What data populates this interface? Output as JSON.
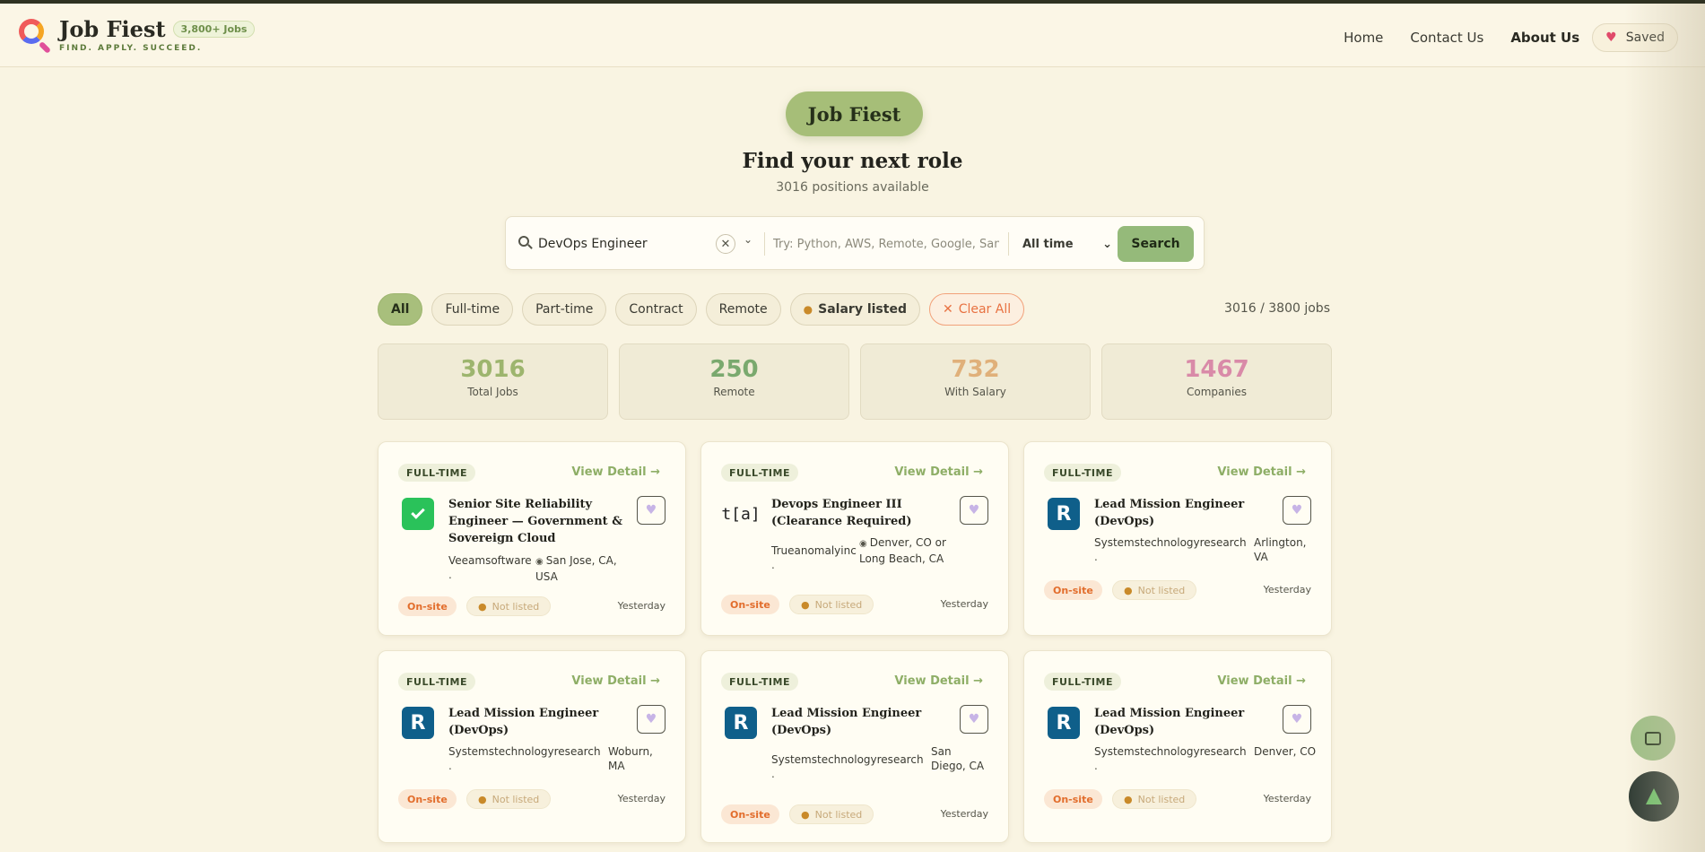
{
  "header": {
    "brand_name": "Job Fiest",
    "jobs_badge": "3,800+ Jobs",
    "tagline": "FIND. APPLY. SUCCEED.",
    "nav": {
      "home": "Home",
      "contact": "Contact Us",
      "about": "About Us",
      "saved": "Saved"
    }
  },
  "hero": {
    "pill": "Job Fiest",
    "title": "Find your next role",
    "subtitle": "3016 positions available"
  },
  "search": {
    "query": "DevOps Engineer",
    "keywords_placeholder": "Try: Python, AWS, Remote, Google, San Francisco",
    "time": "All time",
    "button": "Search"
  },
  "filters": {
    "chips": [
      "All",
      "Full-time",
      "Part-time",
      "Contract",
      "Remote"
    ],
    "salary": "Salary listed",
    "clear": "Clear All",
    "count": "3016 / 3800 jobs"
  },
  "stats": [
    {
      "value": "3016",
      "label": "Total Jobs",
      "color": "#9db56e"
    },
    {
      "value": "250",
      "label": "Remote",
      "color": "#7aa96e"
    },
    {
      "value": "732",
      "label": "With Salary",
      "color": "#e0b07a"
    },
    {
      "value": "1467",
      "label": "Companies",
      "color": "#d98aa8"
    }
  ],
  "cards": [
    {
      "type": "FULL-TIME",
      "view": "View Detail →",
      "title": "Senior Site Reliability Engineer — Government & Sovereign Cloud",
      "company": "Veeamsoftware",
      "dot": ".",
      "location": "San Jose, CA, USA",
      "workplace": "On-site",
      "salary": "Not listed",
      "posted": "Yesterday",
      "logo": "veeam-logo"
    },
    {
      "type": "FULL-TIME",
      "view": "View Detail →",
      "title": "Devops Engineer III (Clearance Required)",
      "company": "Trueanomalyinc",
      "dot": ".",
      "location": "Denver, CO or Long Beach, CA",
      "workplace": "On-site",
      "salary": "Not listed",
      "posted": "Yesterday",
      "logo_text": "t[a]"
    },
    {
      "type": "FULL-TIME",
      "view": "View Detail →",
      "title": "Lead Mission Engineer (DevOps)",
      "company": "Systemstechnologyresearch",
      "dot": ".",
      "location": "Arlington, VA",
      "workplace": "On-site",
      "salary": "Not listed",
      "posted": "Yesterday",
      "logo_text": "R"
    },
    {
      "type": "FULL-TIME",
      "view": "View Detail →",
      "title": "Lead Mission Engineer (DevOps)",
      "company": "Systemstechnologyresearch",
      "dot": ".",
      "location": "Woburn, MA",
      "workplace": "On-site",
      "salary": "Not listed",
      "posted": "Yesterday",
      "logo_text": "R"
    },
    {
      "type": "FULL-TIME",
      "view": "View Detail →",
      "title": "Lead Mission Engineer (DevOps)",
      "company": "Systemstechnologyresearch",
      "dot": ".",
      "location": "San Diego, CA",
      "workplace": "On-site",
      "salary": "Not listed",
      "posted": "Yesterday",
      "logo_text": "R"
    },
    {
      "type": "FULL-TIME",
      "view": "View Detail →",
      "title": "Lead Mission Engineer (DevOps)",
      "company": "Systemstechnologyresearch",
      "dot": ".",
      "location": "Denver, CO",
      "workplace": "On-site",
      "salary": "Not listed",
      "posted": "Yesterday",
      "logo_text": "R"
    }
  ],
  "icons": {
    "chat": "chat-icon",
    "tree": "tree-icon",
    "heart": "heart-icon",
    "money_bag": "money-bag-icon"
  }
}
